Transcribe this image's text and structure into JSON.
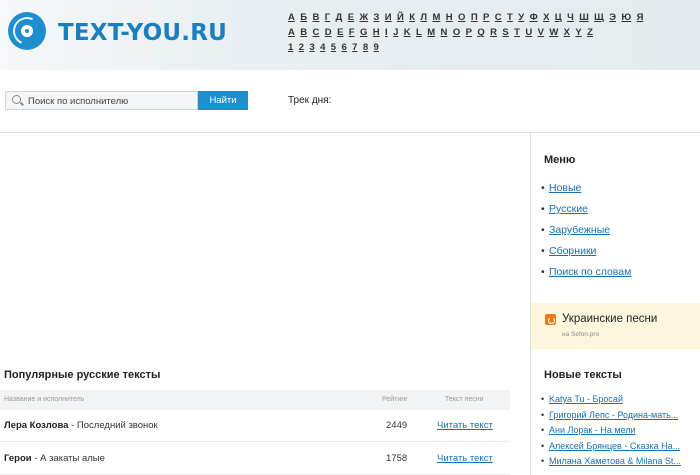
{
  "header": {
    "site_name": "TEXT-YOU.RU",
    "alphabet_cyrillic": [
      "А",
      "Б",
      "В",
      "Г",
      "Д",
      "Е",
      "Ж",
      "З",
      "И",
      "Й",
      "К",
      "Л",
      "М",
      "Н",
      "О",
      "П",
      "Р",
      "С",
      "Т",
      "У",
      "Ф",
      "Х",
      "Ц",
      "Ч",
      "Ш",
      "Щ",
      "Э",
      "Ю",
      "Я"
    ],
    "alphabet_latin": [
      "A",
      "B",
      "C",
      "D",
      "E",
      "F",
      "G",
      "H",
      "I",
      "J",
      "K",
      "L",
      "M",
      "N",
      "O",
      "P",
      "Q",
      "R",
      "S",
      "T",
      "U",
      "V",
      "W",
      "X",
      "Y",
      "Z"
    ],
    "digits": [
      "1",
      "2",
      "3",
      "4",
      "5",
      "6",
      "7",
      "8",
      "9"
    ]
  },
  "search": {
    "placeholder": "Поиск по исполнителю",
    "button_label": "Найти"
  },
  "track_of_day_label": "Трек дня:",
  "popular": {
    "title": "Популярные русские тексты",
    "columns": {
      "name": "Название и исполнитель",
      "rating": "Рейтинг",
      "lyrics": "Текст песни"
    },
    "rows": [
      {
        "artist": "Лера Козлова",
        "sep": " - ",
        "song": "Последний звонок",
        "rating": "2449",
        "link": "Читать текст"
      },
      {
        "artist": "Герои",
        "sep": " - ",
        "song": "А закаты алые",
        "rating": "1758",
        "link": "Читать текст"
      }
    ]
  },
  "sidebar": {
    "menu_title": "Меню",
    "menu_items": [
      "Новые",
      "Русские",
      "Зарубежные",
      "Сборники",
      "Поиск по словам"
    ],
    "ukrainian": {
      "title": "Украинские песни",
      "subtitle": "на Sefon.pro"
    },
    "new_texts_title": "Новые тексты",
    "new_texts": [
      "Katya Tu - Бросай",
      "Григорий Лепс - Родина-мать...",
      "Ани Лорак - На мели",
      "Алексей Брянцев - Сказка На...",
      "Милана Хаметова & Milana St..."
    ]
  },
  "colors": {
    "brand": "#1d8fce",
    "link": "#1a6fb0",
    "promo_bg": "#fcf6dc"
  }
}
